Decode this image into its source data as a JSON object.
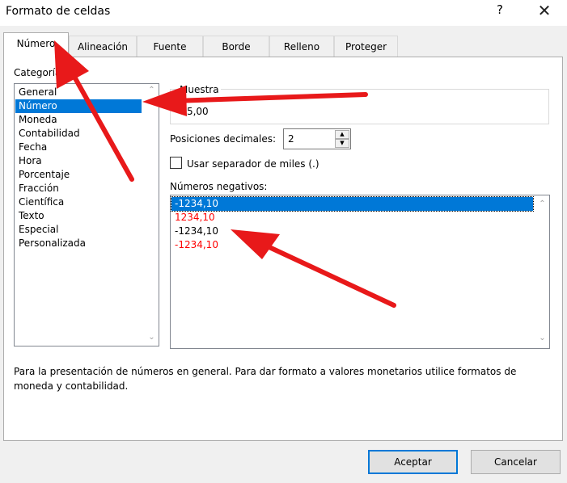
{
  "window": {
    "title": "Formato de celdas",
    "help_glyph": "?",
    "close_glyph": "✕"
  },
  "tabs": [
    {
      "label": "Número",
      "active": true
    },
    {
      "label": "Alineación",
      "active": false
    },
    {
      "label": "Fuente",
      "active": false
    },
    {
      "label": "Borde",
      "active": false
    },
    {
      "label": "Relleno",
      "active": false
    },
    {
      "label": "Proteger",
      "active": false
    }
  ],
  "category": {
    "label": "Categoría:",
    "items": [
      "General",
      "Número",
      "Moneda",
      "Contabilidad",
      "Fecha",
      "Hora",
      "Porcentaje",
      "Fracción",
      "Científica",
      "Texto",
      "Especial",
      "Personalizada"
    ],
    "selected": "Número"
  },
  "sample": {
    "label": "Muestra",
    "value": "-55,00"
  },
  "decimals": {
    "label": "Posiciones decimales:",
    "value": "2"
  },
  "thousands": {
    "label": "Usar separador de miles (.)",
    "checked": false
  },
  "negatives": {
    "label": "Números negativos:",
    "items": [
      {
        "text": "-1234,10",
        "color": "#000000",
        "selected": true
      },
      {
        "text": "1234,10",
        "color": "#ff0000",
        "selected": false
      },
      {
        "text": "-1234,10",
        "color": "#000000",
        "selected": false
      },
      {
        "text": "-1234,10",
        "color": "#ff0000",
        "selected": false
      }
    ]
  },
  "description": "Para la presentación de números en general. Para dar formato a valores monetarios utilice formatos de moneda y contabilidad.",
  "buttons": {
    "ok": "Aceptar",
    "cancel": "Cancelar"
  },
  "annotation_color": "#e8191a",
  "accent_color": "#0078d7"
}
